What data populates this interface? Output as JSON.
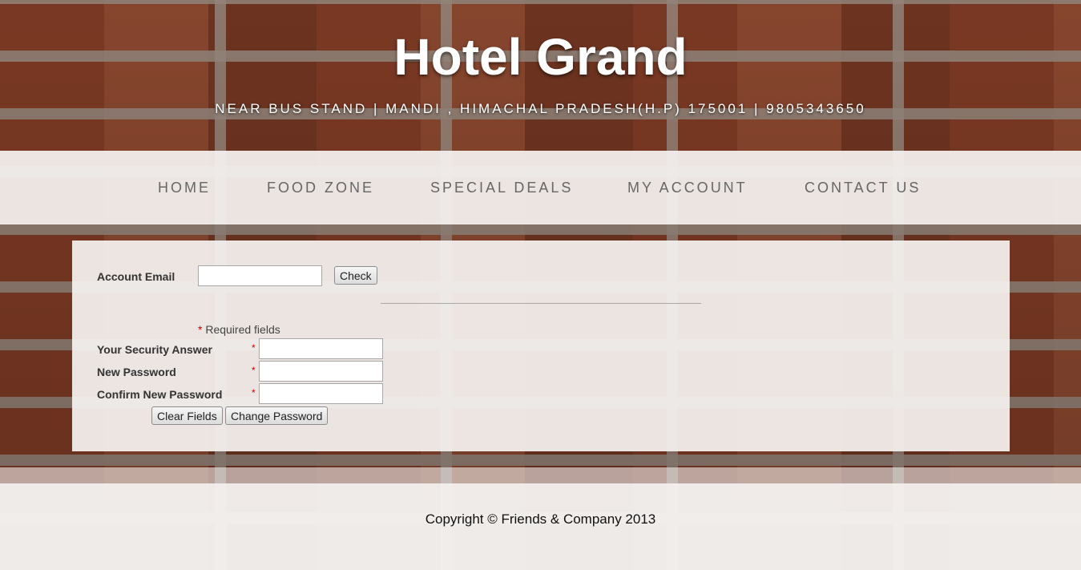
{
  "header": {
    "title": "Hotel Grand",
    "address": "NEAR BUS STAND | MANDI , HIMACHAL PRADESH(H.P) 175001 | 9805343650"
  },
  "nav": {
    "items": [
      {
        "label": "HOME"
      },
      {
        "label": "FOOD ZONE"
      },
      {
        "label": "SPECIAL DEALS"
      },
      {
        "label": "MY ACCOUNT"
      },
      {
        "label": "CONTACT US"
      }
    ]
  },
  "form": {
    "email_label": "Account Email",
    "email_value": "",
    "check_button": "Check",
    "required_star": "*",
    "required_note": " Required fields",
    "security_label": "Your Security Answer",
    "new_password_label": "New Password",
    "confirm_password_label": "Confirm New Password",
    "clear_button": "Clear Fields",
    "change_button": "Change Password"
  },
  "footer": {
    "copyright": "Copyright © Friends & Company 2013"
  }
}
